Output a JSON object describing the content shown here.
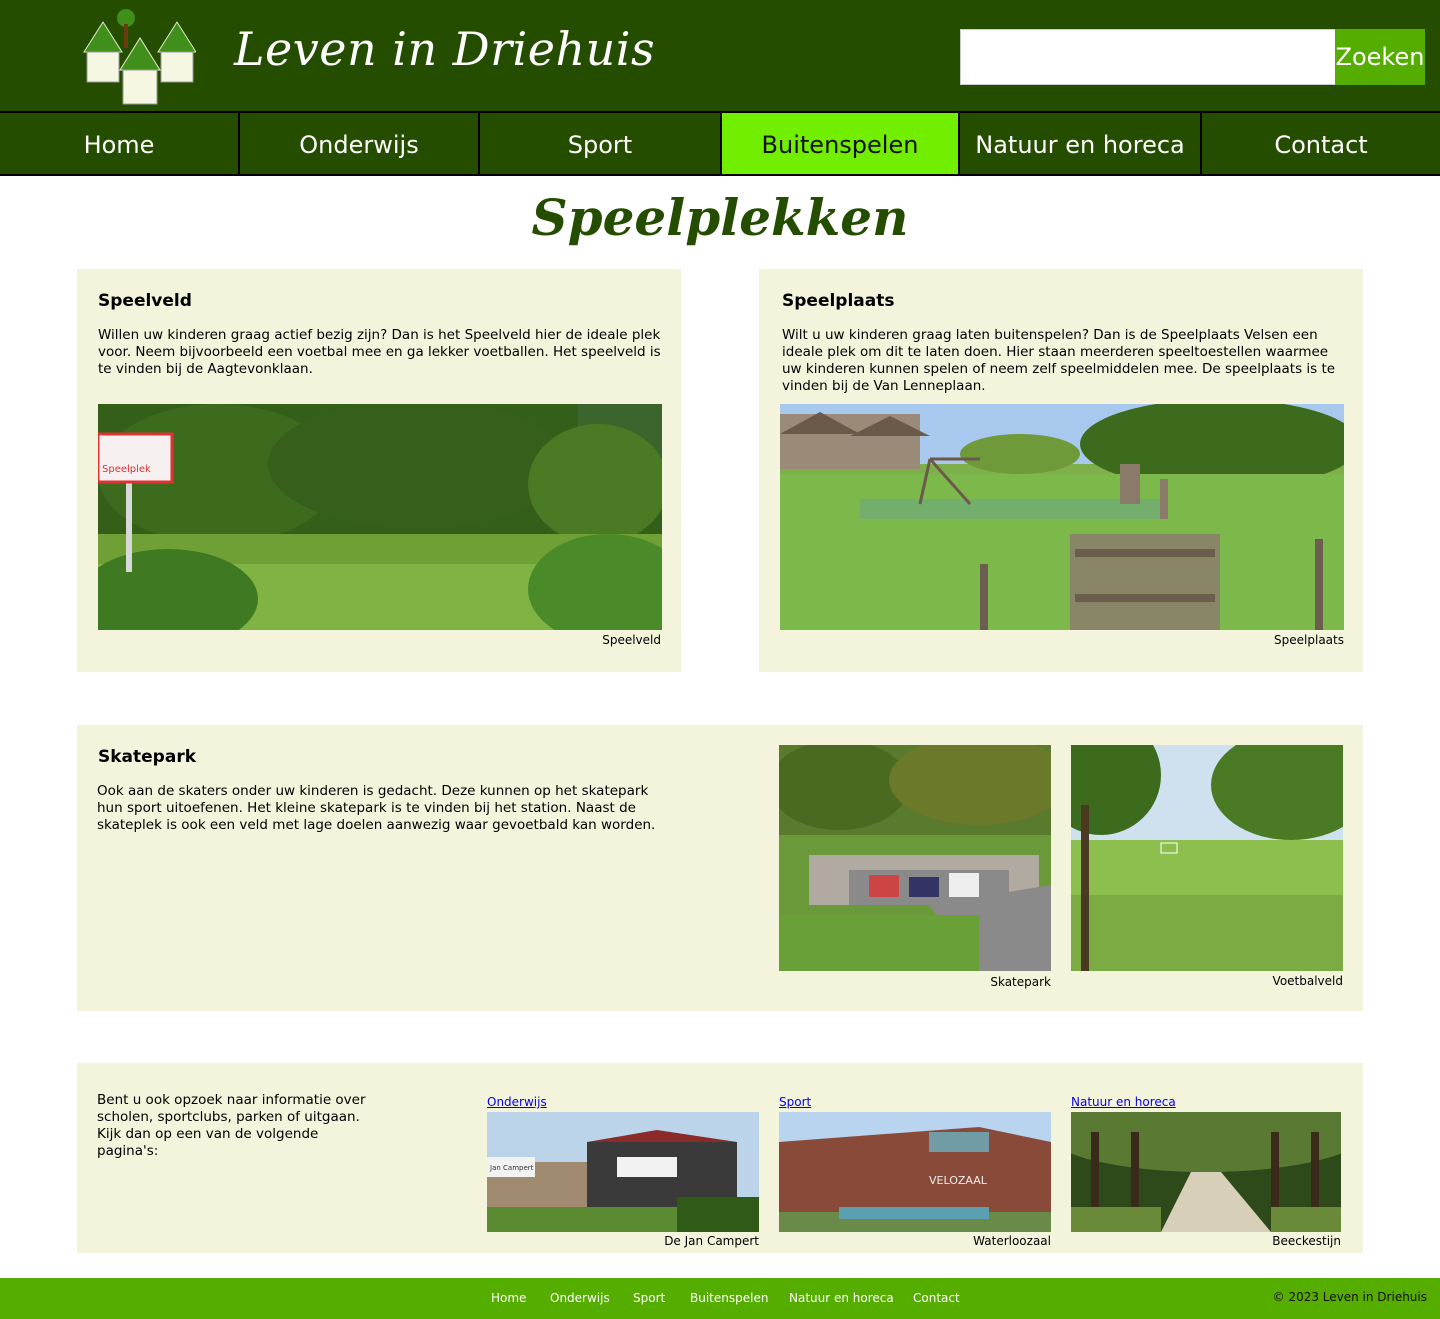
{
  "header": {
    "site_title": "Leven in Driehuis",
    "search_placeholder": "",
    "search_button": "Zoeken"
  },
  "nav": {
    "items": [
      {
        "label": "Home",
        "active": false
      },
      {
        "label": "Onderwijs",
        "active": false
      },
      {
        "label": "Sport",
        "active": false
      },
      {
        "label": "Buitenspelen",
        "active": true
      },
      {
        "label": "Natuur en horeca",
        "active": false
      },
      {
        "label": "Contact",
        "active": false
      }
    ]
  },
  "main": {
    "title": "Speelplekken",
    "speelveld": {
      "heading": "Speelveld",
      "text": "Willen uw kinderen graag actief bezig zijn? Dan is het Speelveld hier de ideale plek voor. Neem bijvoorbeeld een voetbal mee en ga lekker voetballen. Het speelveld is te vinden bij de Aagtevonklaan.",
      "caption": "Speelveld",
      "sign_text": "Speelplek"
    },
    "speelplaats": {
      "heading": "Speelplaats",
      "text": "Wilt u uw kinderen graag laten buitenspelen? Dan is de Speelplaats Velsen een ideale plek om dit te laten doen. Hier staan meerderen speeltoestellen waarmee uw kinderen kunnen spelen of neem zelf speelmiddelen mee. De speelplaats is te vinden bij de Van Lenneplaan.",
      "caption": "Speelplaats"
    },
    "skatepark": {
      "heading": "Skatepark",
      "text": "Ook aan de skaters onder uw kinderen is gedacht. Deze kunnen op het skatepark hun sport uitoefenen. Het kleine skatepark is te vinden bij het station. Naast de skateplek is ook een veld met lage doelen aanwezig waar gevoetbald kan worden.",
      "caption_1": "Skatepark",
      "caption_2": "Voetbalveld"
    },
    "more": {
      "text": "Bent u ook opzoek naar informatie over scholen, sportclubs, parken of uitgaan. Kijk dan op een van de volgende pagina's:",
      "links": [
        {
          "label": "Onderwijs",
          "caption": "De Jan Campert",
          "sign": "Jan Campert"
        },
        {
          "label": "Sport",
          "caption": "Waterloozaal",
          "sign": "VELOZAAL"
        },
        {
          "label": "Natuur en horeca",
          "caption": "Beeckestijn"
        }
      ]
    }
  },
  "footer": {
    "links": [
      "Home",
      "Onderwijs",
      "Sport",
      "Buitenspelen",
      "Natuur en horeca",
      "Contact"
    ],
    "copyright": "© 2023 Leven in Driehuis"
  },
  "colors": {
    "header_bg": "#254d00",
    "nav_active": "#72ef00",
    "accent_green": "#55ad00",
    "card_bg": "#f3f4db"
  }
}
